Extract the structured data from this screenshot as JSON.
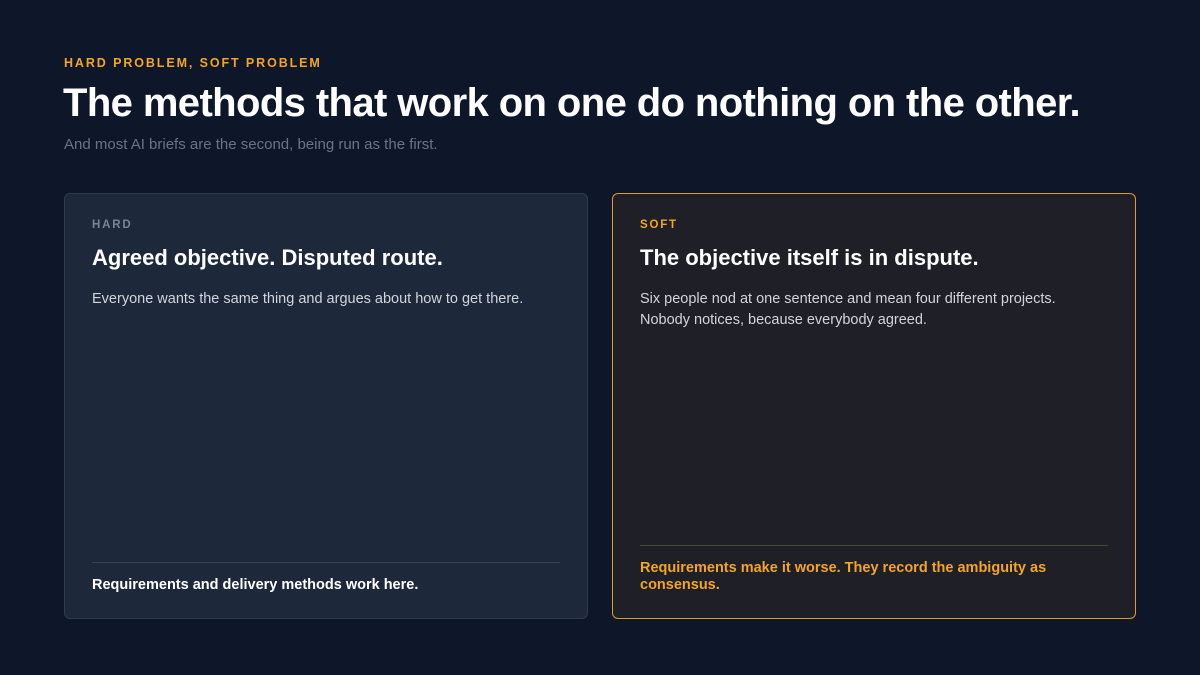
{
  "header": {
    "eyebrow": "HARD PROBLEM, SOFT PROBLEM",
    "title": "The methods that work on one do nothing on the other.",
    "subtitle": "And most AI briefs are the second, being run as the first."
  },
  "cards": [
    {
      "label": "HARD",
      "heading": "Agreed objective. Disputed route.",
      "body": "Everyone wants the same thing and argues about how to get there.",
      "footer": "Requirements and delivery methods work here."
    },
    {
      "label": "SOFT",
      "heading": "The objective itself is in dispute.",
      "body": "Six people nod at one sentence and mean four different projects. Nobody notices, because everybody agreed.",
      "footer": "Requirements make it worse. They record the ambiguity as consensus."
    }
  ],
  "colors": {
    "background": "#0e1629",
    "accent": "#f5a524",
    "hard_card": "#1e283b",
    "soft_card": "#1e1f27"
  }
}
